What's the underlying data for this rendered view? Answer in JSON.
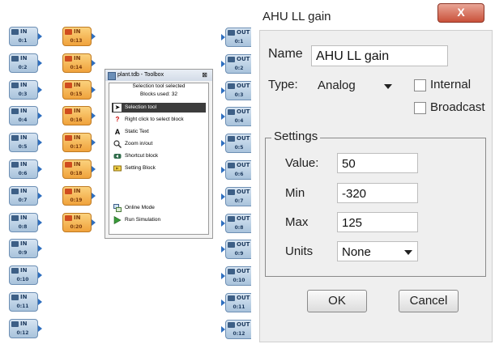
{
  "blocks": {
    "in_left": [
      {
        "type": "IN",
        "id": "0:1"
      },
      {
        "type": "IN",
        "id": "0:2"
      },
      {
        "type": "IN",
        "id": "0:3"
      },
      {
        "type": "IN",
        "id": "0:4"
      },
      {
        "type": "IN",
        "id": "0:5"
      },
      {
        "type": "IN",
        "id": "0:6"
      },
      {
        "type": "IN",
        "id": "0:7"
      },
      {
        "type": "IN",
        "id": "0:8"
      },
      {
        "type": "IN",
        "id": "0:9"
      },
      {
        "type": "IN",
        "id": "0:10"
      },
      {
        "type": "IN",
        "id": "0:11"
      },
      {
        "type": "IN",
        "id": "0:12"
      }
    ],
    "in_mid": [
      {
        "type": "IN",
        "id": "0:13"
      },
      {
        "type": "IN",
        "id": "0:14"
      },
      {
        "type": "IN",
        "id": "0:15"
      },
      {
        "type": "IN",
        "id": "0:16"
      },
      {
        "type": "IN",
        "id": "0:17"
      },
      {
        "type": "IN",
        "id": "0:18"
      },
      {
        "type": "IN",
        "id": "0:19"
      },
      {
        "type": "IN",
        "id": "0:20"
      }
    ],
    "out": [
      {
        "type": "OUT",
        "id": "0:1"
      },
      {
        "type": "OUT",
        "id": "0:2"
      },
      {
        "type": "OUT",
        "id": "0:3"
      },
      {
        "type": "OUT",
        "id": "0:4"
      },
      {
        "type": "OUT",
        "id": "0:5"
      },
      {
        "type": "OUT",
        "id": "0:6"
      },
      {
        "type": "OUT",
        "id": "0:7"
      },
      {
        "type": "OUT",
        "id": "0:8"
      },
      {
        "type": "OUT",
        "id": "0:9"
      },
      {
        "type": "OUT",
        "id": "0:10"
      },
      {
        "type": "OUT",
        "id": "0:11"
      },
      {
        "type": "OUT",
        "id": "0:12"
      }
    ]
  },
  "toolbox": {
    "title": "plant.tdb - Toolbox",
    "close": "⊠",
    "status": "Selection tool selected",
    "blocks_used": "Blocks used: 32",
    "tools": [
      {
        "label": "Selection tool",
        "icon": "arrow-cursor-icon"
      },
      {
        "label": "Right click to select block",
        "icon": "question-icon"
      },
      {
        "label": "Static Text",
        "icon": "text-a-icon"
      },
      {
        "label": "Zoom in/out",
        "icon": "magnifier-icon"
      },
      {
        "label": "Shortcut block",
        "icon": "shortcut-icon"
      },
      {
        "label": "Setting Block",
        "icon": "setting-block-icon"
      }
    ],
    "modes": [
      {
        "label": "Online Mode",
        "icon": "online-icon"
      },
      {
        "label": "Run Simulation",
        "icon": "play-icon"
      }
    ]
  },
  "dialog": {
    "title": "AHU LL gain",
    "close_label": "X",
    "name_label": "Name",
    "name_value": "AHU LL gain",
    "type_label": "Type:",
    "type_value": "Analog",
    "internal_label": "Internal",
    "broadcast_label": "Broadcast",
    "settings_label": "Settings",
    "value_label": "Value:",
    "value": "50",
    "min_label": "Min",
    "min_value": "-320",
    "max_label": "Max",
    "max_value": "125",
    "units_label": "Units",
    "units_value": "None",
    "ok_label": "OK",
    "cancel_label": "Cancel"
  },
  "colors": {
    "in_block": "#a9c3dc",
    "in_mid_block": "#f0a23c",
    "dialog_close": "#c9513a"
  }
}
